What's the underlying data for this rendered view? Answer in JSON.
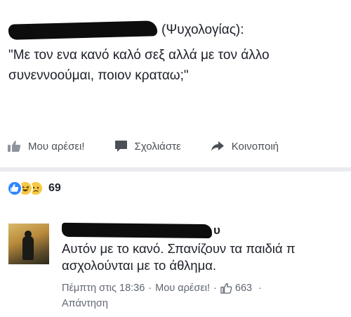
{
  "post": {
    "group_name": "(Ψυχολογίας):",
    "text_line1": "\"Με τον ενα κανό καλό σεξ αλλά με τον άλλο",
    "text_line2": "συνεννοούμαι, ποιον κραταω;\""
  },
  "actions": {
    "like_label": "Μου αρέσει!",
    "comment_label": "Σχολιάστε",
    "share_label": "Κοινοποιή"
  },
  "reactions": {
    "count": "69",
    "types": [
      "like-icon",
      "haha-icon",
      "sad-icon"
    ]
  },
  "comment": {
    "author_tail": "υ",
    "text_line1": "Αυτόν με το κανό. Σπανίζουν τα παιδιά π",
    "text_line2": "ασχολούνται με το άθλημα.",
    "timestamp": "Πέμπτη στις 18:36",
    "like_link": "Μου αρέσει!",
    "like_count": "663",
    "reply_link": "Απάντηση"
  },
  "colors": {
    "text": "#1d2129",
    "secondary": "#606770",
    "action": "#4b4f56",
    "like_blue": "#2d88ff",
    "divider": "#e9ebee"
  }
}
